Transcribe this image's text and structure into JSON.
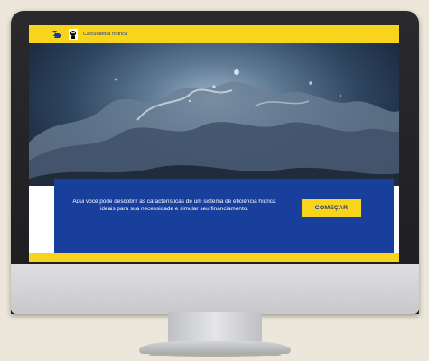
{
  "header": {
    "brand_label": "Calculadora hídrica",
    "icons": [
      "banco-do-brasil-logo-icon",
      "wwf-panda-logo-icon"
    ]
  },
  "hero": {
    "image": "water-splash-image"
  },
  "intro": {
    "text": "Aqui você pode descobrir as características de um sistema de eficiência hídrica ideais para sua necessidade e simular seu financiamento.",
    "button_label": "COMEÇAR"
  },
  "colors": {
    "brand_yellow": "#f9d41c",
    "brand_blue": "#173f9b",
    "background": "#ece7da"
  }
}
